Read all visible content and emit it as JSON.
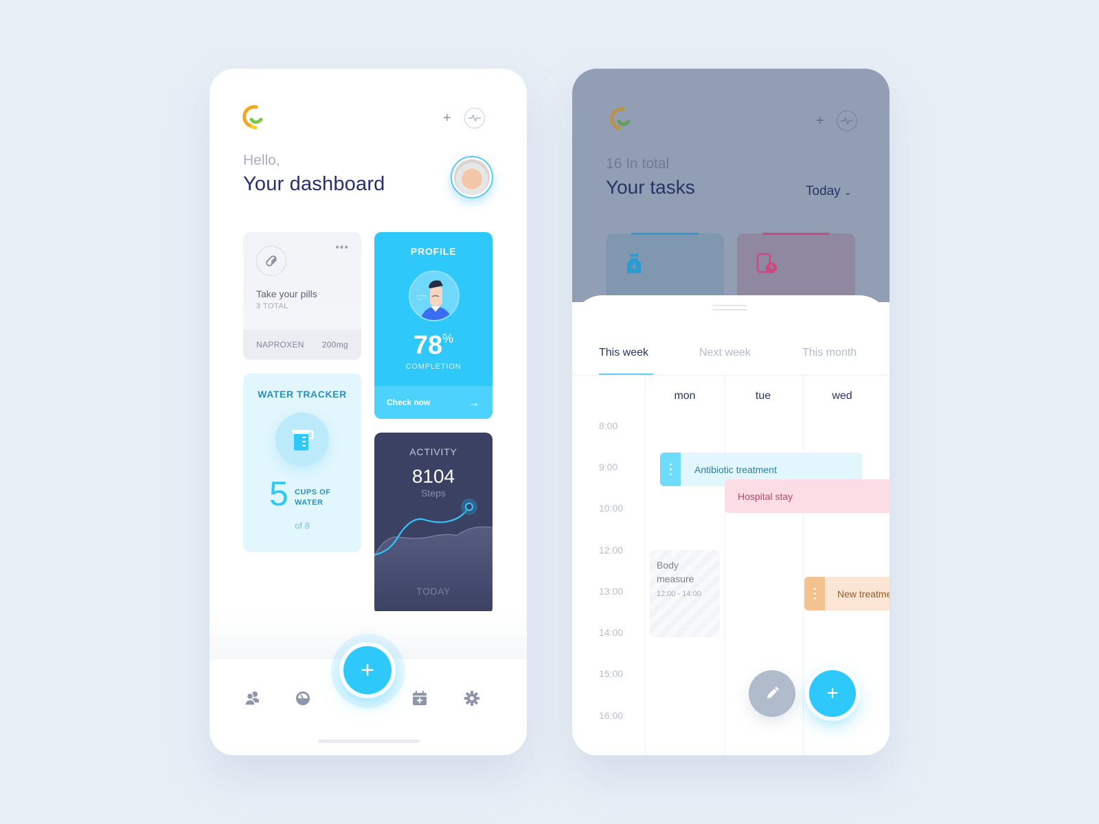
{
  "dashboard": {
    "header": {
      "logo": "app-logo",
      "plus_label": "+",
      "pulse_icon": "heart-pulse-icon"
    },
    "greeting": "Hello,",
    "title": "Your dashboard",
    "pills": {
      "title": "Take your pills",
      "subtitle": "3 TOTAL",
      "medicine": "NAPROXEN",
      "dose": "200mg",
      "menu": "•••"
    },
    "profile": {
      "label": "PROFILE",
      "completion_value": "78",
      "completion_unit": "%",
      "completion_label": "COMPLETION",
      "cta": "Check now",
      "cta_arrow": "→"
    },
    "water": {
      "label": "WATER TRACKER",
      "cups": "5",
      "cups_label_1": "CUPS OF",
      "cups_label_2": "WATER",
      "of_total": "of 8"
    },
    "activity": {
      "label": "ACTIVITY",
      "steps": "8104",
      "steps_label": "Steps",
      "period": "TODAY"
    },
    "fab_label": "+",
    "tabbar": [
      "people-icon",
      "gauge-icon",
      "calendar-plus-icon",
      "gear-icon"
    ]
  },
  "tasks": {
    "header": {
      "plus_label": "+"
    },
    "subtitle": "16 In total",
    "title": "Your tasks",
    "filter": "Today",
    "filter_chevron": "⌄",
    "tabs": [
      {
        "label": "This week",
        "active": true
      },
      {
        "label": "Next week",
        "active": false
      },
      {
        "label": "This month",
        "active": false
      }
    ],
    "days": [
      "mon",
      "tue",
      "wed"
    ],
    "times": [
      "8:00",
      "9:00",
      "10:00",
      "12:00",
      "13:00",
      "14:00",
      "15:00",
      "16:00"
    ],
    "events": {
      "antibiotic": "Antibiotic treatment",
      "hospital": "Hospital stay",
      "body_title_1": "Body",
      "body_title_2": "measure",
      "body_time": "12:00 - 14:00",
      "new_treatment": "New treatment"
    },
    "fab_label": "+"
  },
  "colors": {
    "accent": "#2ec8fb",
    "navy": "#263467",
    "activity_bg": "#3b4163",
    "hospital": "#fddde5",
    "antibiotic": "#e1f6fd",
    "treatment": "#fbe6d6"
  }
}
